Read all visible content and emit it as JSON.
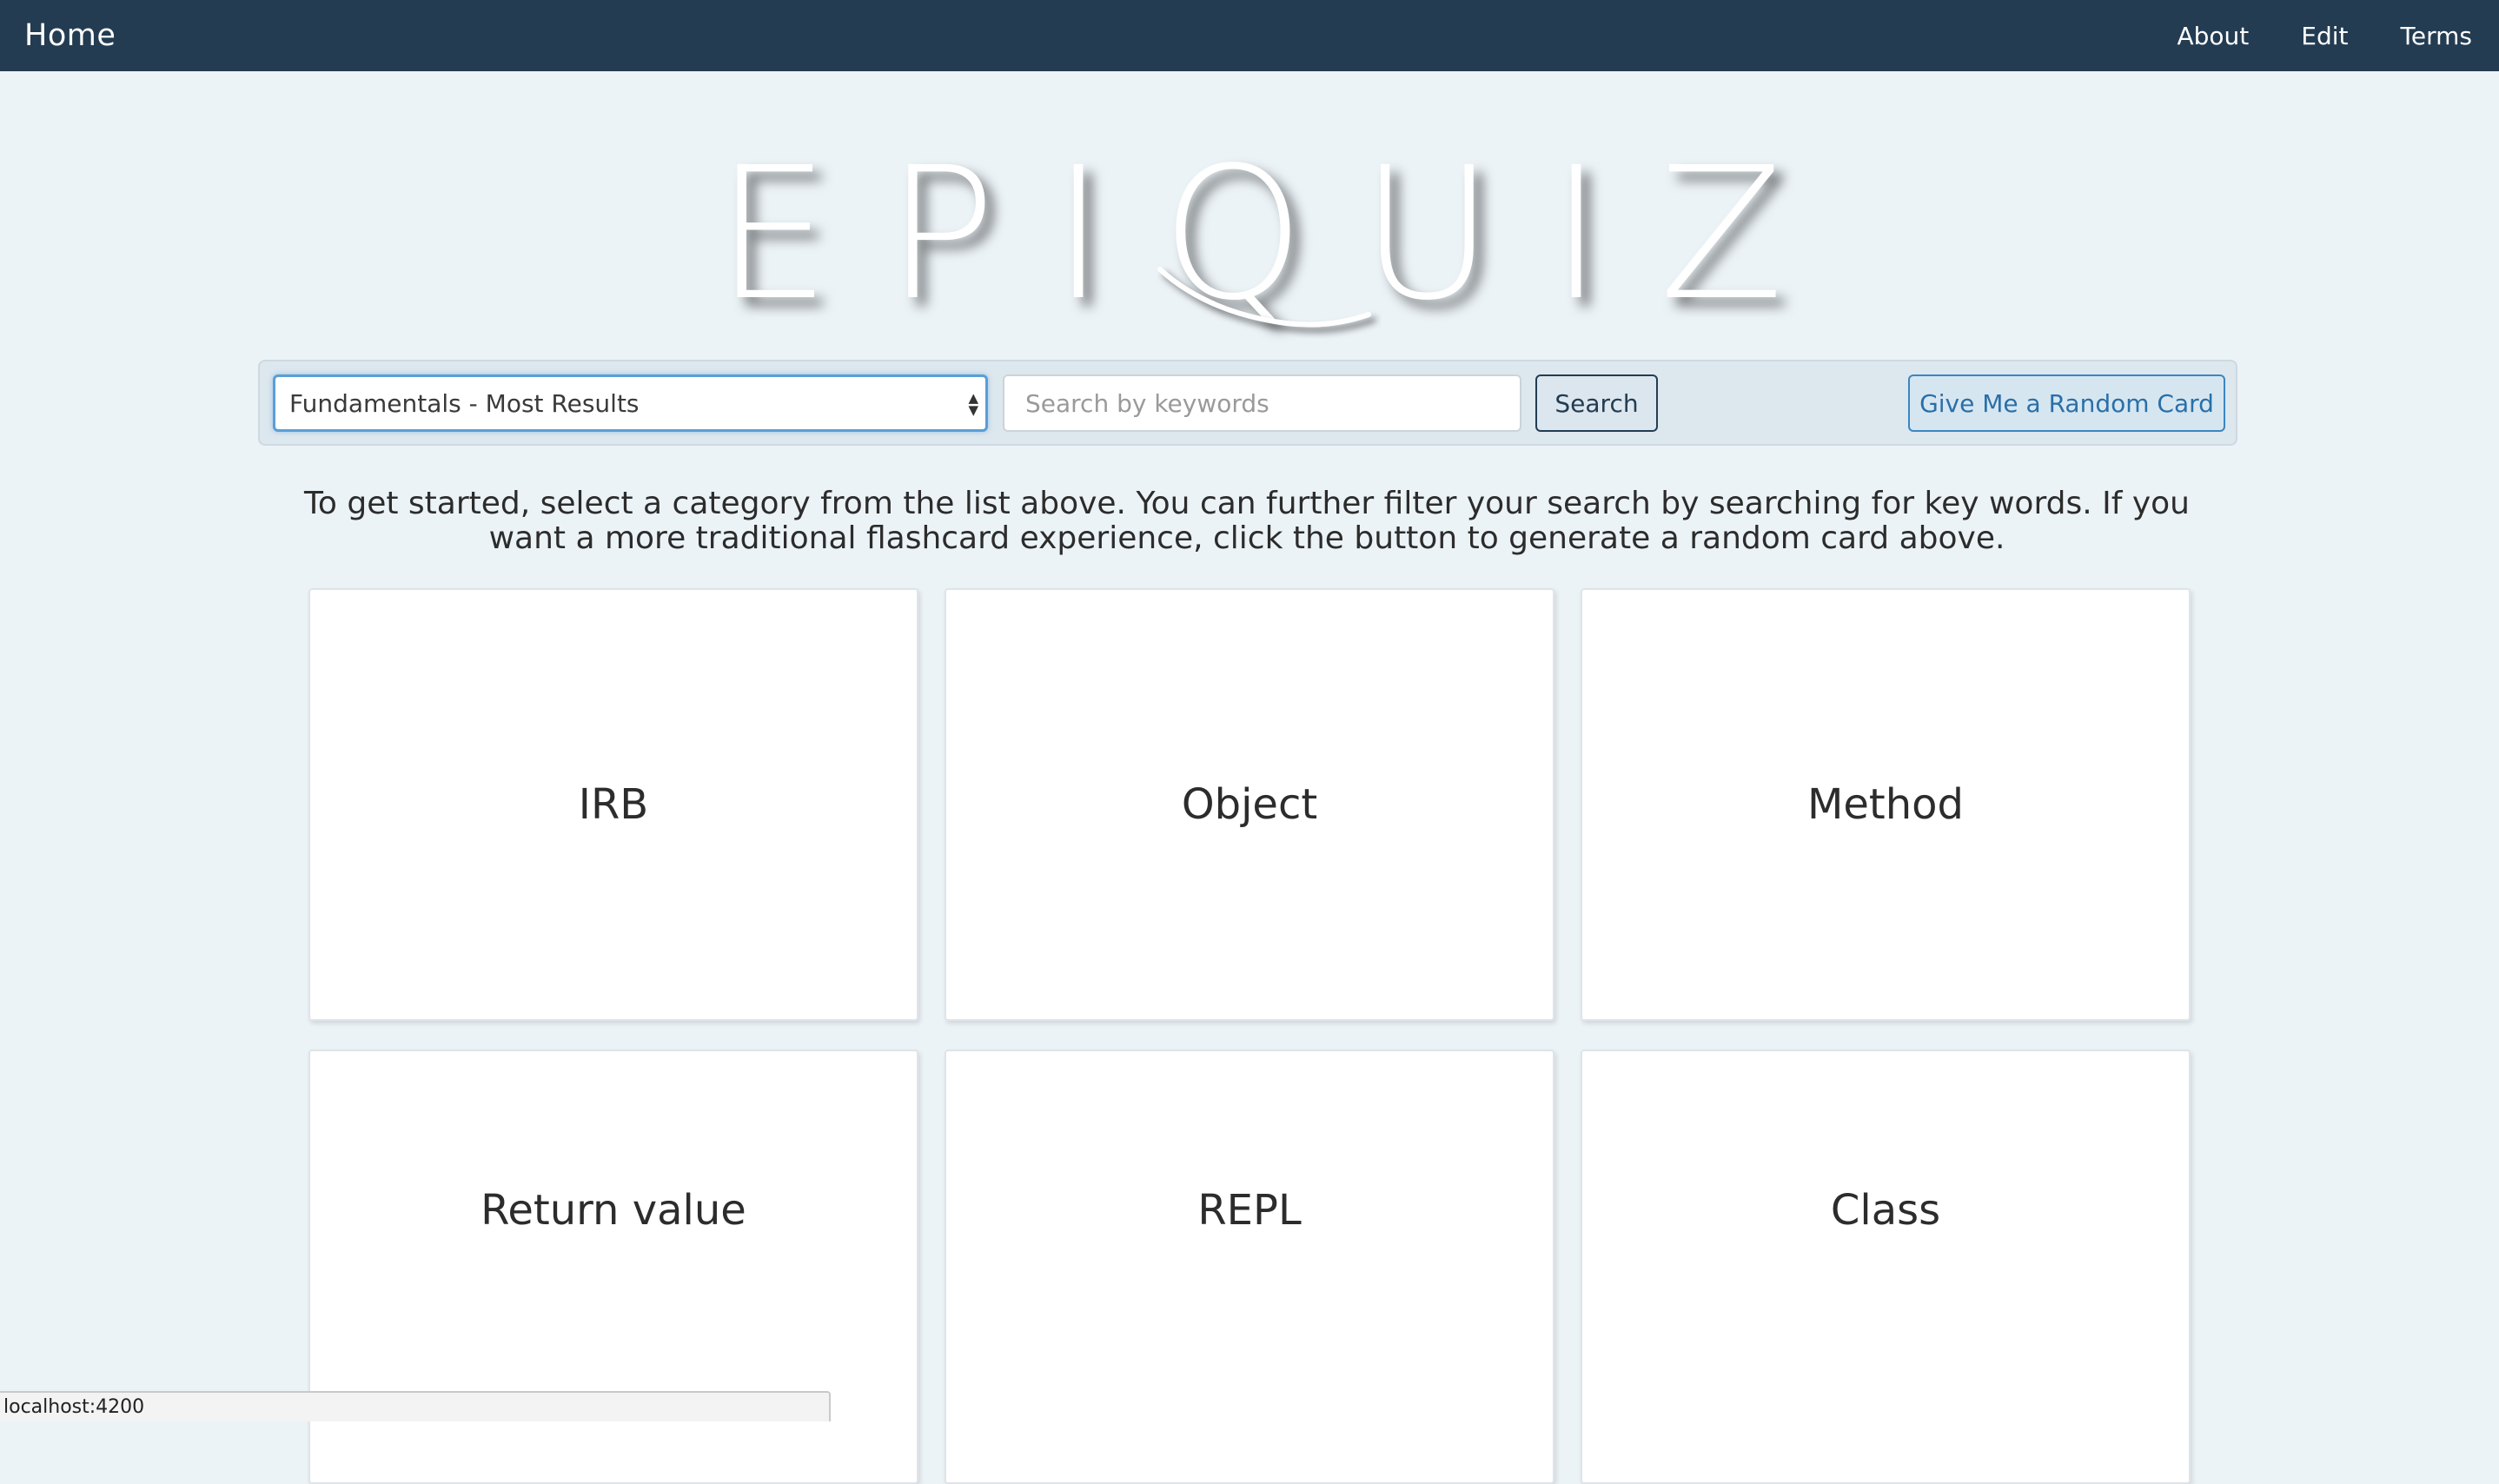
{
  "nav": {
    "home": "Home",
    "links": [
      "About",
      "Edit",
      "Terms"
    ]
  },
  "logo": {
    "text": "EPIQUIZ"
  },
  "search": {
    "category_selected": "Fundamentals - Most Results",
    "keyword_placeholder": "Search by keywords",
    "search_label": "Search",
    "random_label": "Give Me a Random Card"
  },
  "intro": {
    "text": "To get started, select a category from the list above. You can further filter your search by searching for key words. If you want a more traditional flashcard experience, click the button to generate a random card above."
  },
  "cards": [
    "IRB",
    "Object",
    "Method",
    "Return value",
    "REPL",
    "Class"
  ],
  "status": {
    "url": "localhost:4200"
  },
  "colors": {
    "navbar": "#233c52",
    "background": "#ecf3f7",
    "accent": "#3a87c2"
  }
}
